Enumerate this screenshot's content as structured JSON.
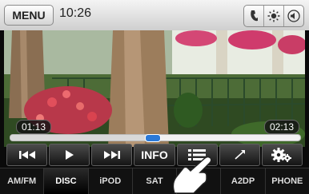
{
  "topbar": {
    "menu_label": "MENU",
    "clock": "10:26",
    "icons": [
      "phone-icon",
      "brightness-icon",
      "volume-mute-icon"
    ]
  },
  "playback": {
    "elapsed": "01:13",
    "total": "02:13",
    "progress_fraction": 0.49
  },
  "controls": {
    "info_label": "INFO",
    "icons": [
      "previous-track-icon",
      "play-icon",
      "next-track-icon",
      "list-icon",
      "repeat-icon",
      "settings-icon"
    ]
  },
  "sources": [
    {
      "label": "AM/FM",
      "active": false
    },
    {
      "label": "DISC",
      "active": true
    },
    {
      "label": "iPOD",
      "active": false
    },
    {
      "label": "SAT",
      "active": false
    },
    {
      "label": "",
      "active": false
    },
    {
      "label": "A2DP",
      "active": false
    },
    {
      "label": "PHONE",
      "active": false
    }
  ]
}
